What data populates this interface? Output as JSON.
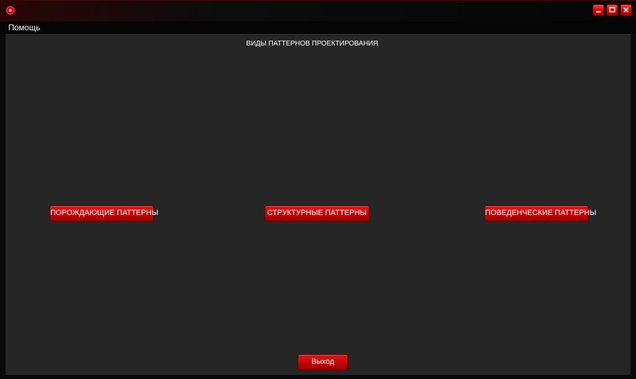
{
  "menu": {
    "help_label": "Помощь"
  },
  "main": {
    "title": "ВИДЫ ПАТТЕРНОВ ПРОЕКТИРОВАНИЯ",
    "buttons": {
      "creational": "ПОРОЖДАЮЩИЕ ПАТТЕРНЫ",
      "structural": "СТРУКТУРНЫЕ ПАТТЕРНЫ",
      "behavioral": "ПОВЕДЕНЧЕСКИЕ ПАТТЕРНЫ"
    },
    "exit_label": "Выход"
  },
  "window_controls": {
    "minimize_icon": "minimize-icon",
    "maximize_icon": "maximize-icon",
    "close_icon": "close-icon"
  },
  "colors": {
    "accent": "#d80e0e",
    "background": "#262626",
    "frame": "#0a0a0a",
    "text": "#ffffff"
  }
}
